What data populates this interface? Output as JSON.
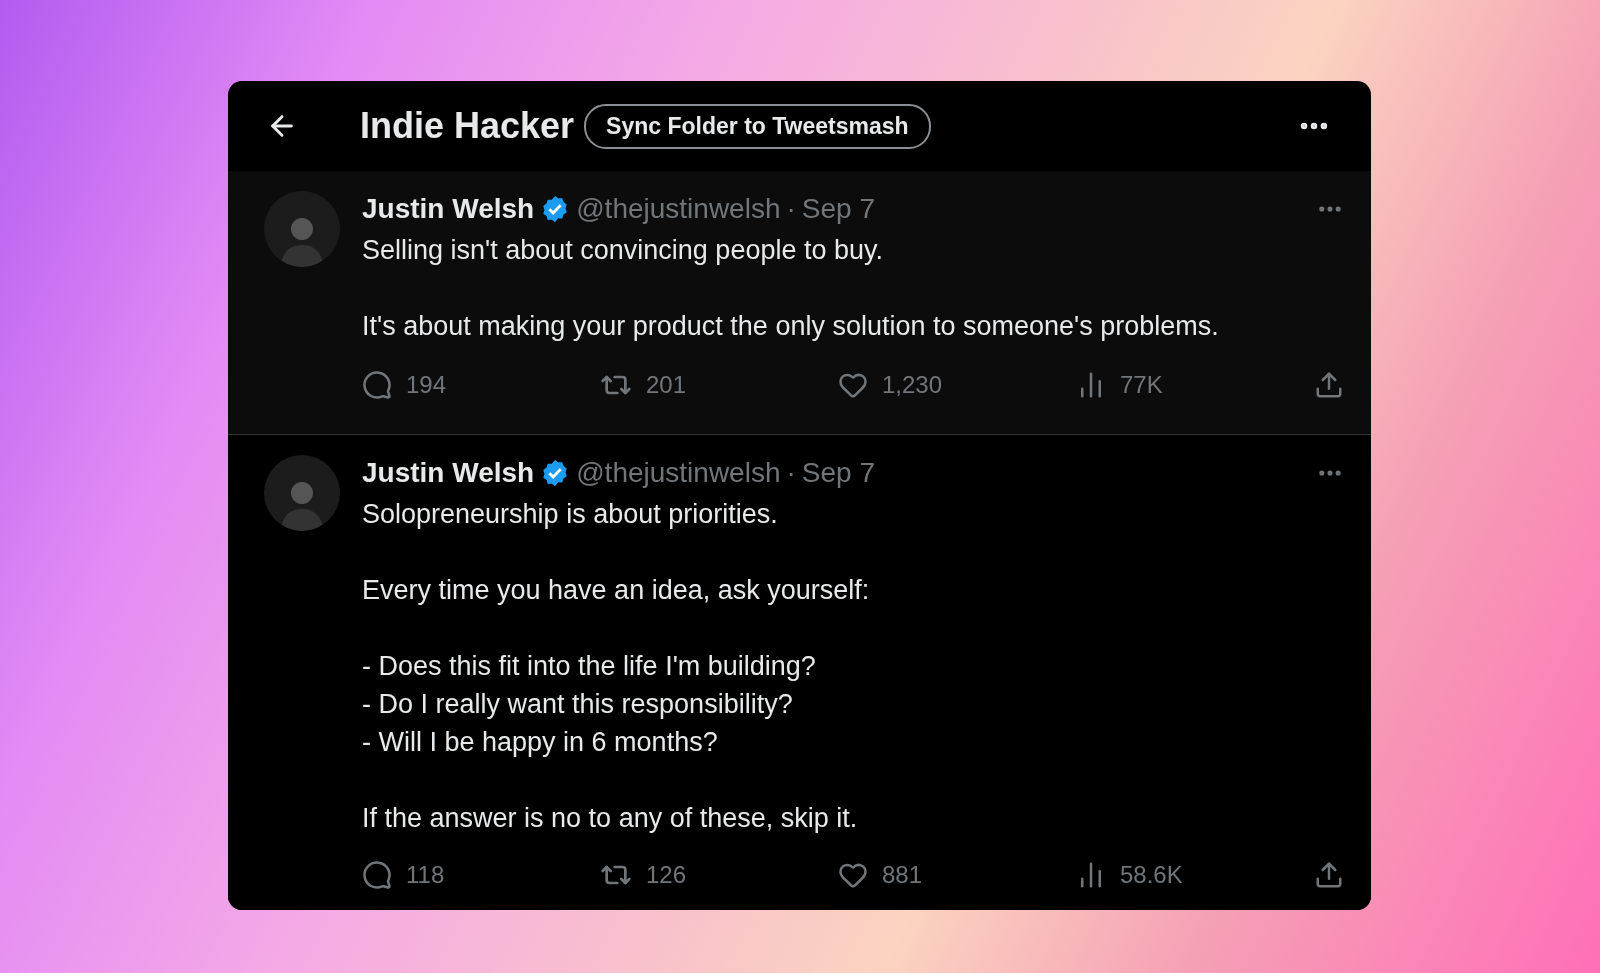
{
  "header": {
    "title": "Indie Hacker",
    "action_button": "Sync Folder to Tweetsmash"
  },
  "tweets": [
    {
      "highlighted": true,
      "name": "Justin Welsh",
      "verified": true,
      "handle": "@thejustinwelsh",
      "separator": "·",
      "date": "Sep 7",
      "paragraphs": [
        "Selling isn't about convincing people to buy.",
        "It's about making your product the only solution to someone's problems."
      ],
      "stats": {
        "replies": "194",
        "reposts": "201",
        "likes": "1,230",
        "views": "77K"
      }
    },
    {
      "highlighted": false,
      "name": "Justin Welsh",
      "verified": true,
      "handle": "@thejustinwelsh",
      "separator": "·",
      "date": "Sep 7",
      "paragraphs": [
        "Solopreneurship is about priorities.",
        "Every time you have an idea, ask yourself:",
        "- Does this fit into the life I'm building?\n- Do I really want this responsibility?\n- Will I be happy in 6 months?",
        "If the answer is no to any of these, skip it."
      ],
      "stats": {
        "replies": "118",
        "reposts": "126",
        "likes": "881",
        "views": "58.6K"
      }
    }
  ]
}
